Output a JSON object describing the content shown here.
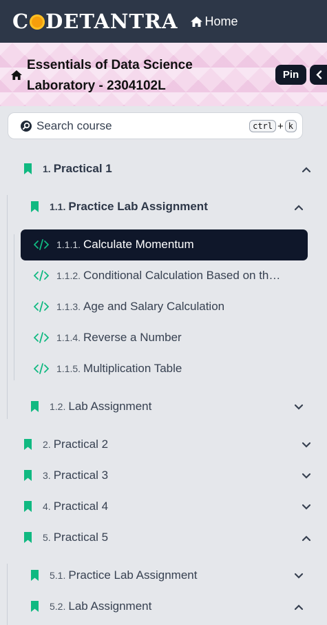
{
  "navbar": {
    "brand": "CODETANTRA",
    "brand_pre": "C",
    "brand_post": "DETANTRA",
    "home_label": "Home"
  },
  "course": {
    "title": "Essentials of Data Science Laboratory - 2304102L",
    "pin_label": "Pin"
  },
  "search": {
    "placeholder": "Search course",
    "shortcut_key1": "ctrl",
    "shortcut_plus": "+",
    "shortcut_key2": "k"
  },
  "tree": {
    "p1": {
      "num": "1.",
      "label": "Practical 1",
      "expanded": true
    },
    "p1_1": {
      "num": "1.1.",
      "label": "Practice Lab Assignment",
      "expanded": true
    },
    "items": [
      {
        "num": "1.1.1.",
        "label": "Calculate Momentum",
        "active": true
      },
      {
        "num": "1.1.2.",
        "label": "Conditional Calculation Based on th…",
        "active": false
      },
      {
        "num": "1.1.3.",
        "label": "Age and Salary Calculation",
        "active": false
      },
      {
        "num": "1.1.4.",
        "label": "Reverse a Number",
        "active": false
      },
      {
        "num": "1.1.5.",
        "label": "Multiplication Table",
        "active": false
      }
    ],
    "p1_2": {
      "num": "1.2.",
      "label": "Lab Assignment",
      "expanded": false
    },
    "p2": {
      "num": "2.",
      "label": "Practical 2",
      "expanded": false
    },
    "p3": {
      "num": "3.",
      "label": "Practical 3",
      "expanded": false
    },
    "p4": {
      "num": "4.",
      "label": "Practical 4",
      "expanded": false
    },
    "p5": {
      "num": "5.",
      "label": "Practical 5",
      "expanded": true
    },
    "p5_1": {
      "num": "5.1.",
      "label": "Practice Lab Assignment",
      "expanded": false
    },
    "p5_2": {
      "num": "5.2.",
      "label": "Lab Assignment",
      "expanded": true
    }
  },
  "colors": {
    "navbar_bg": "#2d3748",
    "accent_green": "#10b981",
    "active_bg": "#0f172a",
    "header_pink": "#f5d9ec"
  }
}
